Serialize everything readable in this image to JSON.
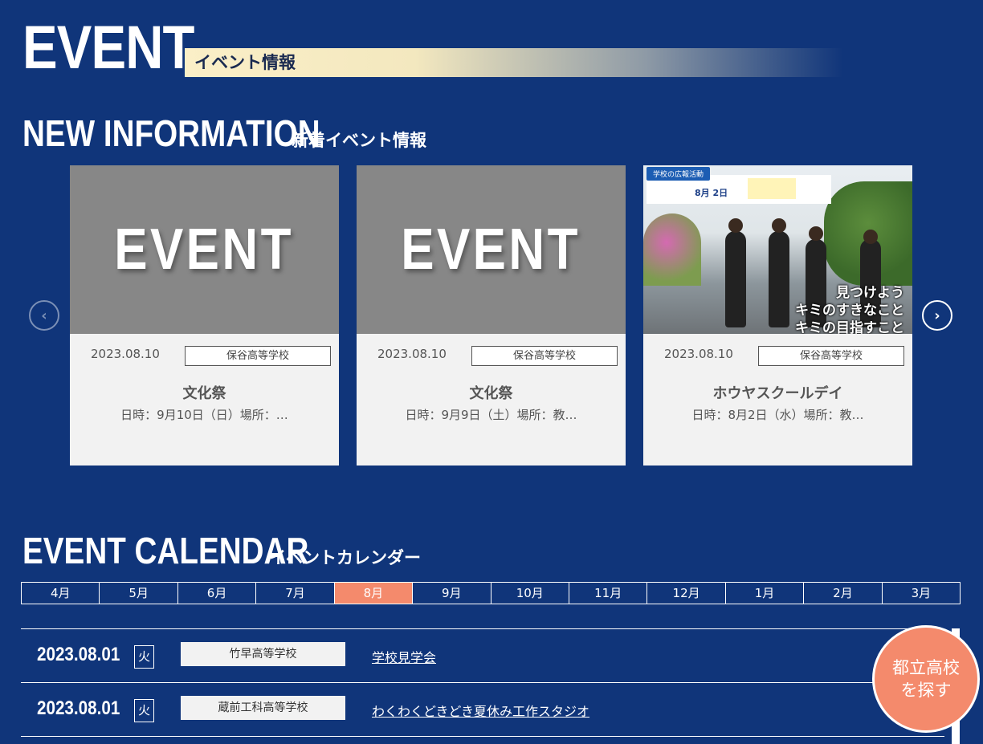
{
  "hero": {
    "title_en": "EVENT",
    "title_jp": "イベント情報"
  },
  "new_info": {
    "title_en": "NEW INFORMATION",
    "title_jp": "新着イベント情報",
    "cards": [
      {
        "image_text": "EVENT",
        "date": "2023.08.10",
        "school": "保谷高等学校",
        "title": "文化祭",
        "desc": "日時：9月10日（日）場所：…"
      },
      {
        "image_text": "EVENT",
        "date": "2023.08.10",
        "school": "保谷高等学校",
        "title": "文化祭",
        "desc": "日時：9月9日（土）場所：教…"
      },
      {
        "date": "2023.08.10",
        "school": "保谷高等学校",
        "title": "ホウヤスクールデイ",
        "desc": "日時：8月2日（水）場所：教…",
        "photo": {
          "tag": "学校の広報活動",
          "date_text": "8月 2日",
          "catch_1": "見つけよう",
          "catch_2": "キミのすきなこと",
          "catch_3": "キミの目指すこと"
        }
      }
    ],
    "prev_icon": "chevron-left-icon",
    "next_icon": "chevron-right-icon"
  },
  "calendar": {
    "title_en": "EVENT CALENDAR",
    "title_jp": "イベントカレンダー",
    "months": [
      "4月",
      "5月",
      "6月",
      "7月",
      "8月",
      "9月",
      "10月",
      "11月",
      "12月",
      "1月",
      "2月",
      "3月"
    ],
    "active_month": "8月",
    "events": [
      {
        "date": "2023.08.01",
        "dow": "火",
        "school": "竹早高等学校",
        "title": "学校見学会"
      },
      {
        "date": "2023.08.01",
        "dow": "火",
        "school": "蔵前工科高等学校",
        "title": "わくわくどきどき夏休み工作スタジオ"
      }
    ]
  },
  "fab": {
    "line1": "都立高校",
    "line2": "を探す"
  },
  "colors": {
    "background": "#10357a",
    "accent": "#f48a6c",
    "card": "#f2f2f2"
  }
}
